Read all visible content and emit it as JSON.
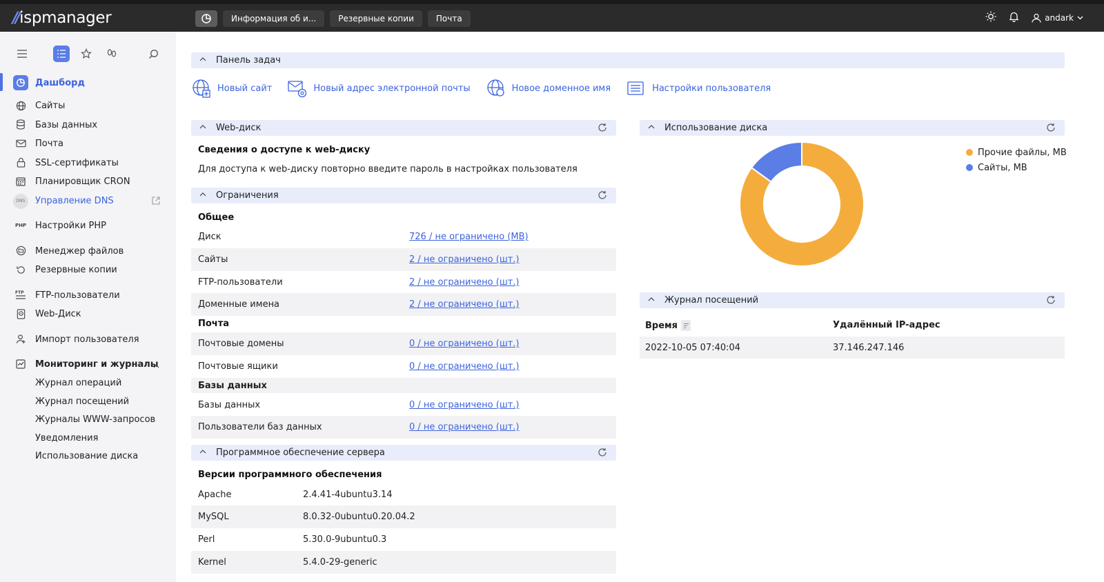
{
  "header": {
    "logo_text": "ispmanager",
    "tabs": [
      "Информация об и...",
      "Резервные копии",
      "Почта"
    ],
    "user": "andark"
  },
  "sidebar": {
    "items": [
      {
        "label": "Дашборд",
        "icon": "dashboard-icon",
        "active": true
      },
      {
        "label": "Сайты",
        "icon": "globe-icon"
      },
      {
        "label": "Базы данных",
        "icon": "database-icon"
      },
      {
        "label": "Почта",
        "icon": "mail-icon"
      },
      {
        "label": "SSL-сертификаты",
        "icon": "lock-icon"
      },
      {
        "label": "Планировщик CRON",
        "icon": "calendar-icon"
      },
      {
        "label": "Управление DNS",
        "icon": "dns-icon"
      },
      {
        "label": "Настройки PHP",
        "icon": "php-icon"
      },
      {
        "label": "Менеджер файлов",
        "icon": "folder-icon"
      },
      {
        "label": "Резервные копии",
        "icon": "backup-icon"
      },
      {
        "label": "FTP-пользователи",
        "icon": "ftp-icon"
      },
      {
        "label": "Web-Диск",
        "icon": "webdisk-icon"
      },
      {
        "label": "Импорт пользователя",
        "icon": "user-import-icon"
      },
      {
        "label": "Мониторинг и журналы",
        "icon": "monitoring-icon"
      }
    ],
    "dns_badge": "DNS",
    "php_badge": "PHP",
    "ftp_badge": "FTP",
    "sub_items": [
      "Журнал операций",
      "Журнал посещений",
      "Журналы WWW-запросов",
      "Уведомления",
      "Использование диска"
    ]
  },
  "tasks": {
    "title": "Панель задач",
    "items": [
      "Новый сайт",
      "Новый адрес электронной почты",
      "Новое доменное имя",
      "Настройки пользователя"
    ]
  },
  "webdisk": {
    "title": "Web-диск",
    "subtitle": "Сведения о доступе к web-диску",
    "text": "Для доступа к web-диску повторно введите пароль в настройках пользователя"
  },
  "limits": {
    "title": "Ограничения",
    "groups": [
      {
        "name": "Общее",
        "rows": [
          {
            "k": "Диск",
            "v": "726 / не ограничено (MB)"
          },
          {
            "k": "Сайты",
            "v": "2 / не ограничено (шт.)"
          },
          {
            "k": "FTP-пользователи",
            "v": "2 / не ограничено (шт.)"
          },
          {
            "k": "Доменные имена",
            "v": "2 / не ограничено (шт.)"
          }
        ]
      },
      {
        "name": "Почта",
        "rows": [
          {
            "k": "Почтовые домены",
            "v": "0 / не ограничено (шт.)"
          },
          {
            "k": "Почтовые ящики",
            "v": "0 / не ограничено (шт.)"
          }
        ]
      },
      {
        "name": "Базы данных",
        "rows": [
          {
            "k": "Базы данных",
            "v": "0 / не ограничено (шт.)"
          },
          {
            "k": "Пользователи баз данных",
            "v": "0 / не ограничено (шт.)"
          }
        ]
      }
    ]
  },
  "software": {
    "title": "Программное обеспечение сервера",
    "subtitle": "Версии программного обеспечения",
    "rows": [
      {
        "k": "Apache",
        "v": "2.4.41-4ubuntu3.14"
      },
      {
        "k": "MySQL",
        "v": "8.0.32-0ubuntu0.20.04.2"
      },
      {
        "k": "Perl",
        "v": "5.30.0-9ubuntu0.3"
      },
      {
        "k": "Kernel",
        "v": "5.4.0-29-generic"
      }
    ]
  },
  "disk_usage": {
    "title": "Использование диска"
  },
  "chart_data": {
    "type": "pie",
    "categories": [
      "Прочие файлы, MB",
      "Сайты, MB"
    ],
    "values": [
      85,
      15
    ],
    "colors": [
      "#f4ad3d",
      "#5a7de6"
    ],
    "legend_position": "top-right",
    "donut": true
  },
  "visits": {
    "title": "Журнал посещений",
    "columns": [
      "Время",
      "Удалённый IP-адрес"
    ],
    "rows": [
      [
        "2022-10-05 07:40:04",
        "37.146.247.146"
      ]
    ]
  }
}
